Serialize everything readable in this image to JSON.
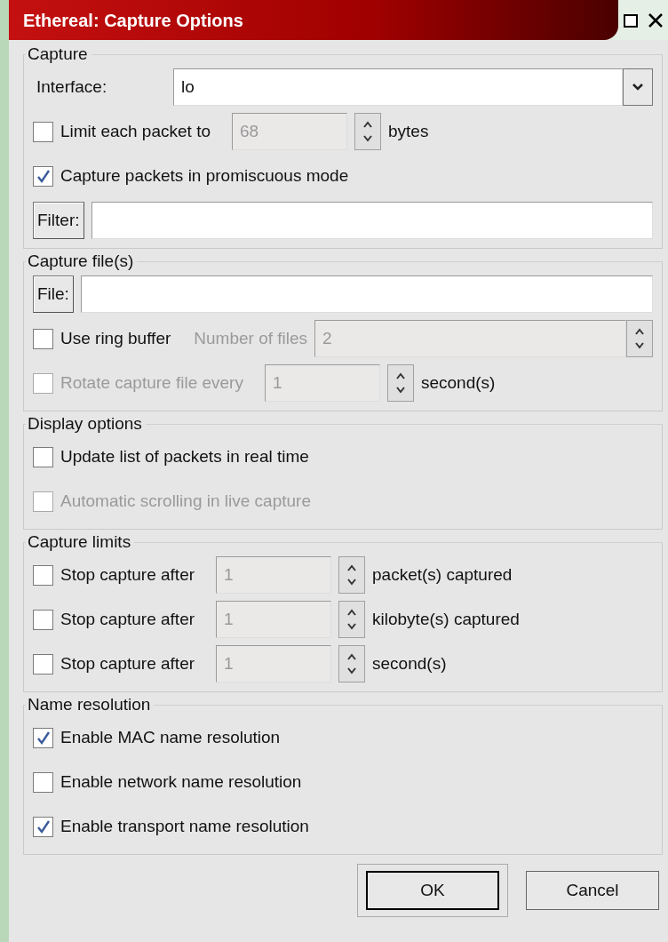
{
  "window": {
    "title": "Ethereal: Capture Options"
  },
  "sections": [
    {
      "title": "Capture",
      "rows": [
        {
          "kind": "combo",
          "label": "Interface:",
          "value": "lo"
        },
        {
          "kind": "check_spin",
          "check": {
            "label": "Limit each packet to",
            "checked": false,
            "disabled": false
          },
          "spin": {
            "value": "68",
            "disabled": true
          },
          "unit": "bytes"
        },
        {
          "kind": "check",
          "check": {
            "label": "Capture packets in promiscuous mode",
            "checked": true,
            "disabled": false
          }
        },
        {
          "kind": "button_field",
          "button": "Filter:"
        }
      ]
    },
    {
      "title": "Capture file(s)",
      "rows": [
        {
          "kind": "button_field",
          "button": "File:"
        },
        {
          "kind": "check_named_spin",
          "check": {
            "label": "Use ring buffer",
            "checked": false,
            "disabled": false
          },
          "spin_label": "Number of files",
          "spin": {
            "value": "2",
            "disabled": true
          }
        },
        {
          "kind": "check_spin",
          "check": {
            "label": "Rotate capture file every",
            "checked": false,
            "disabled": true
          },
          "spin": {
            "value": "1",
            "disabled": true
          },
          "unit": "second(s)"
        }
      ]
    },
    {
      "title": "Display options",
      "rows": [
        {
          "kind": "check",
          "check": {
            "label": "Update list of packets in real time",
            "checked": false,
            "disabled": false
          }
        },
        {
          "kind": "check",
          "check": {
            "label": "Automatic scrolling in live capture",
            "checked": false,
            "disabled": true
          }
        }
      ]
    },
    {
      "title": "Capture limits",
      "rows": [
        {
          "kind": "check_spin",
          "check": {
            "label": "Stop capture after",
            "checked": false,
            "disabled": false
          },
          "spin": {
            "value": "1",
            "disabled": true
          },
          "unit": "packet(s) captured"
        },
        {
          "kind": "check_spin",
          "check": {
            "label": "Stop capture after",
            "checked": false,
            "disabled": false
          },
          "spin": {
            "value": "1",
            "disabled": true
          },
          "unit": "kilobyte(s) captured"
        },
        {
          "kind": "check_spin",
          "check": {
            "label": "Stop capture after",
            "checked": false,
            "disabled": false
          },
          "spin": {
            "value": "1",
            "disabled": true
          },
          "unit": "second(s)"
        }
      ]
    },
    {
      "title": "Name resolution",
      "rows": [
        {
          "kind": "check",
          "check": {
            "label": "Enable MAC name resolution",
            "checked": true,
            "disabled": false
          }
        },
        {
          "kind": "check",
          "check": {
            "label": "Enable network name resolution",
            "checked": false,
            "disabled": false
          }
        },
        {
          "kind": "check",
          "check": {
            "label": "Enable transport name resolution",
            "checked": true,
            "disabled": false
          }
        }
      ]
    }
  ],
  "buttons": [
    {
      "label": "OK",
      "default": true
    },
    {
      "label": "Cancel",
      "default": false
    }
  ]
}
